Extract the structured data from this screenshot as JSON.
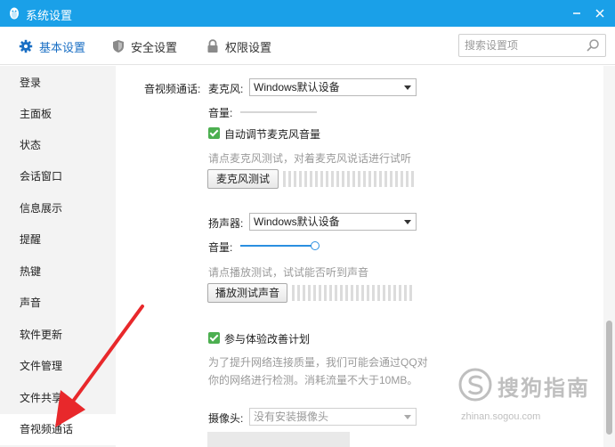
{
  "window": {
    "title": "系统设置"
  },
  "tabs": [
    {
      "label": "基本设置",
      "icon": "gear-icon",
      "active": true
    },
    {
      "label": "安全设置",
      "icon": "shield-icon",
      "active": false
    },
    {
      "label": "权限设置",
      "icon": "lock-icon",
      "active": false
    }
  ],
  "search": {
    "placeholder": "搜索设置项"
  },
  "sidebar": {
    "items": [
      {
        "label": "登录"
      },
      {
        "label": "主面板"
      },
      {
        "label": "状态"
      },
      {
        "label": "会话窗口"
      },
      {
        "label": "信息展示"
      },
      {
        "label": "提醒"
      },
      {
        "label": "热键"
      },
      {
        "label": "声音"
      },
      {
        "label": "软件更新"
      },
      {
        "label": "文件管理"
      },
      {
        "label": "文件共享"
      },
      {
        "label": "音视频通话"
      }
    ],
    "active": "音视频通话"
  },
  "av": {
    "section_label": "音视频通话:",
    "mic": {
      "label": "麦克风:",
      "device": "Windows默认设备",
      "volume_label": "音量:",
      "volume_level": 0.0,
      "auto_adjust_label": "自动调节麦克风音量",
      "auto_adjust_checked": true,
      "hint": "请点麦克风测试，对着麦克风说话进行试听",
      "test_button": "麦克风测试"
    },
    "speaker": {
      "label": "扬声器:",
      "device": "Windows默认设备",
      "volume_label": "音量:",
      "volume_level": 1.0,
      "hint": "请点播放测试，试试能否听到声音",
      "test_button": "播放测试声音"
    },
    "improve": {
      "label": "参与体验改善计划",
      "checked": true,
      "desc_line1": "为了提升网络连接质量，我们可能会通过QQ对",
      "desc_line2": "你的网络进行检测。消耗流量不大于10MB。"
    },
    "camera": {
      "label": "摄像头:",
      "device": "没有安装摄像头"
    }
  },
  "watermark": {
    "main": "搜狗指南",
    "url": "zhinan.sogou.com"
  },
  "colors": {
    "titlebar": "#1aa0e8",
    "accent": "#1a6fc4",
    "arrow": "#e8282b",
    "check": "#4caf50"
  }
}
